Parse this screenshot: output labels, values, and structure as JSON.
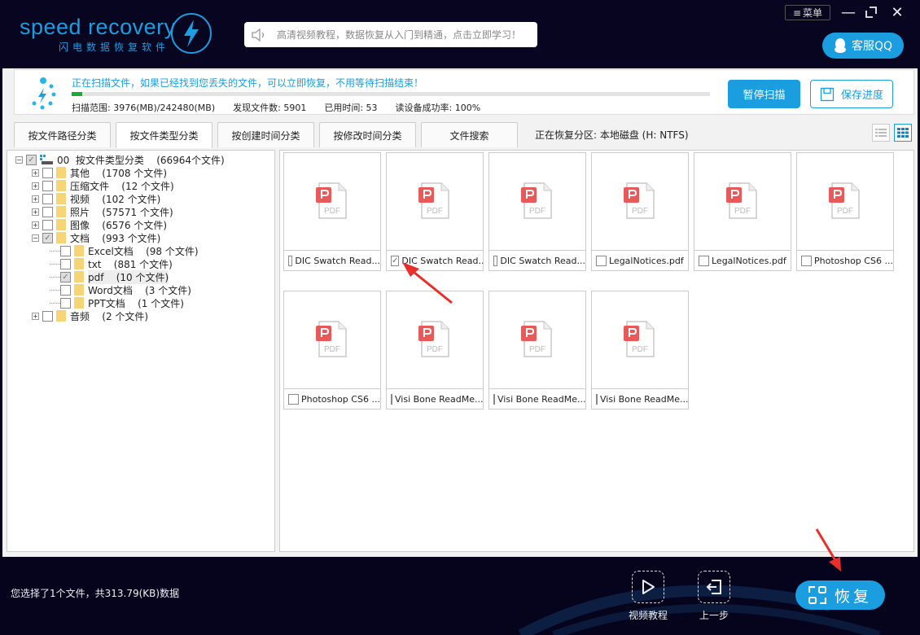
{
  "app": {
    "logo_text": "speed recovery",
    "logo_subtitle": "闪电数据恢复软件",
    "notice_text": "高清视频教程，数据恢复从入门到精通，点击立即学习！",
    "menu_label": "菜单",
    "qq_label": "客服QQ",
    "minimize_glyph": "—",
    "maximize_glyph": "⌐",
    "close_glyph": "✕"
  },
  "scan": {
    "message": "正在扫描文件，如果已经找到您丢失的文件，可以立即恢复，不用等待扫描结束！",
    "progress_fraction": 0.016,
    "range_label": "扫描范围: 3976(MB)/242480(MB)",
    "found_label": "发现文件数: 5901",
    "elapsed_label": "已用时间: 53",
    "success_label": "读设备成功率: 100%",
    "pause_label": "暂停扫描",
    "save_label": "保存进度",
    "accent": "#1a9ee0",
    "progress_color": "#1aaa3a"
  },
  "tabs": [
    {
      "label": "按文件路径分类",
      "active": false
    },
    {
      "label": "按文件类型分类",
      "active": true
    },
    {
      "label": "按创建时间分类",
      "active": false
    },
    {
      "label": "按修改时间分类",
      "active": false
    },
    {
      "label": "文件搜索",
      "active": false
    }
  ],
  "partition_label": "正在恢复分区: 本地磁盘 (H: NTFS)",
  "tree": {
    "root": {
      "id": "00",
      "label": "按文件类型分类",
      "count": "(66964个文件)",
      "checked": "partial"
    },
    "items": [
      {
        "label": "其他",
        "count": "(1708 个文件)",
        "checked": false,
        "expand": "+"
      },
      {
        "label": "压缩文件",
        "count": "(12 个文件)",
        "checked": false,
        "expand": "+"
      },
      {
        "label": "视频",
        "count": "(102 个文件)",
        "checked": false,
        "expand": "+"
      },
      {
        "label": "照片",
        "count": "(57571 个文件)",
        "checked": false,
        "expand": "+"
      },
      {
        "label": "图像",
        "count": "(6576 个文件)",
        "checked": false,
        "expand": "+"
      },
      {
        "label": "文档",
        "count": "(993 个文件)",
        "checked": "partial",
        "expand": "−"
      }
    ],
    "doc_children": [
      {
        "label": "Excel文档",
        "count": "(98 个文件)",
        "checked": false
      },
      {
        "label": "txt",
        "count": "(881 个文件)",
        "checked": false
      },
      {
        "label": "pdf",
        "count": "(10 个文件)",
        "checked": "partial",
        "selected": true
      },
      {
        "label": "Word文档",
        "count": "(3 个文件)",
        "checked": false
      },
      {
        "label": "PPT文档",
        "count": "(1 个文件)",
        "checked": false
      }
    ],
    "last": {
      "label": "音频",
      "count": "(2 个文件)",
      "checked": false,
      "expand": "+"
    }
  },
  "files": [
    {
      "name": "DIC Swatch Read...",
      "checked": false
    },
    {
      "name": "DIC Swatch Read...",
      "checked": true
    },
    {
      "name": "DIC Swatch Read...",
      "checked": false
    },
    {
      "name": "LegalNotices.pdf",
      "checked": false
    },
    {
      "name": "LegalNotices.pdf",
      "checked": false
    },
    {
      "name": "Photoshop CS6 ...",
      "checked": false
    },
    {
      "name": "Photoshop CS6 ...",
      "checked": false
    },
    {
      "name": "Visi Bone ReadMe...",
      "checked": false
    },
    {
      "name": "Visi Bone ReadMe...",
      "checked": false
    },
    {
      "name": "Visi Bone ReadMe...",
      "checked": false
    }
  ],
  "pdf_icon_text": "PDF",
  "footer": {
    "selection_text": "您选择了1个文件，共313.79(KB)数据",
    "video_label": "视频教程",
    "back_label": "上一步",
    "recover_label": "恢复"
  }
}
